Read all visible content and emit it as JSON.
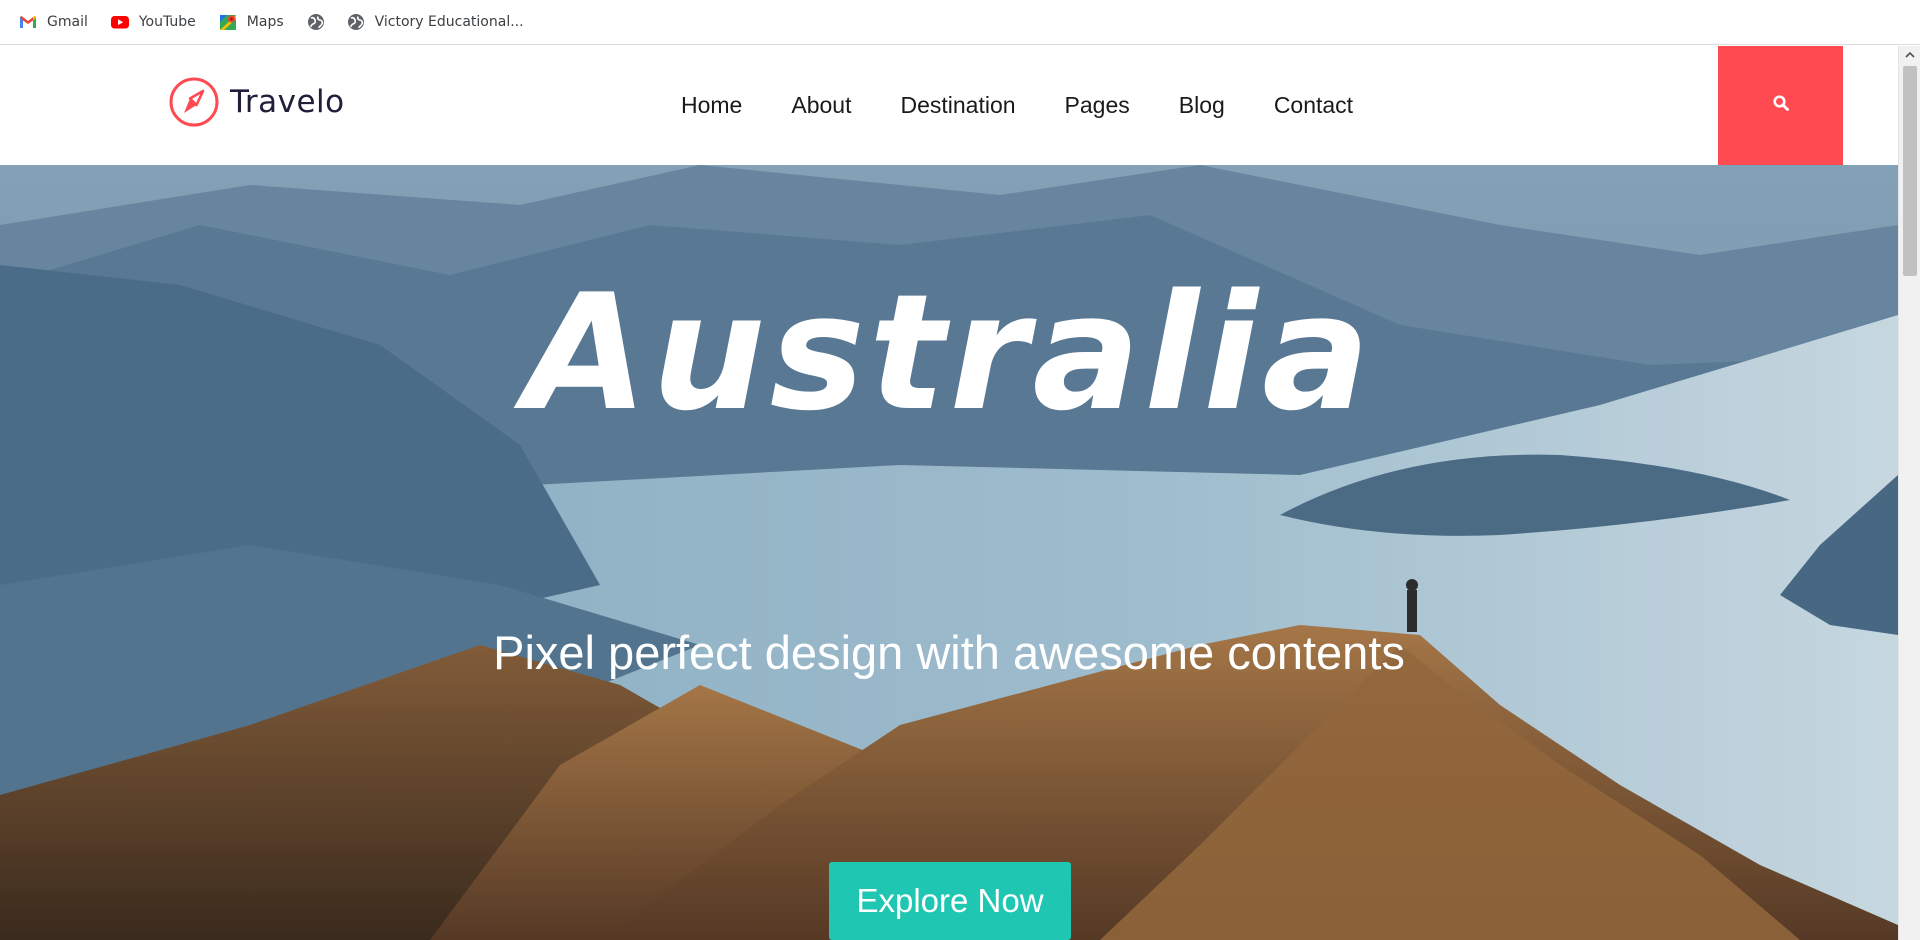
{
  "bookmarks": {
    "items": [
      {
        "label": "Gmail",
        "icon": "gmail-icon"
      },
      {
        "label": "YouTube",
        "icon": "youtube-icon"
      },
      {
        "label": "Maps",
        "icon": "maps-icon"
      },
      {
        "label": "",
        "icon": "globe-icon"
      },
      {
        "label": "Victory Educational...",
        "icon": "globe-icon"
      }
    ]
  },
  "header": {
    "logo_text": "Travelo",
    "nav": [
      "Home",
      "About",
      "Destination",
      "Pages",
      "Blog",
      "Contact"
    ],
    "search_icon": "search-icon"
  },
  "hero": {
    "title": "Australia",
    "subtitle": "Pixel perfect design with awesome contents",
    "button_label": "Explore Now"
  },
  "colors": {
    "accent": "#ff4a52",
    "button": "#1fc7b3",
    "nav_text": "#1a1a1a"
  }
}
